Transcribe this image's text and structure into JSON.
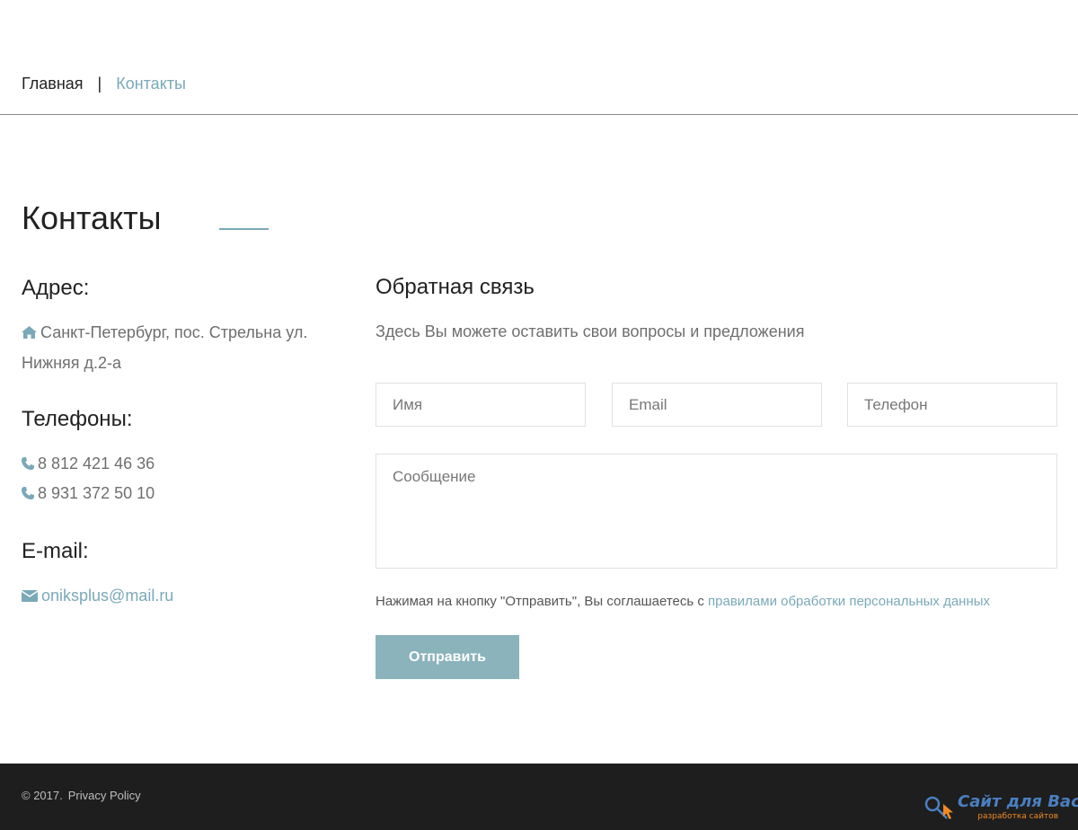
{
  "breadcrumb": {
    "home": "Главная",
    "separator": "|",
    "current": "Контакты"
  },
  "page_title": "Контакты",
  "address": {
    "heading": "Адрес:",
    "line1": "Санкт-Петербург, пос. Стрельна ул.",
    "line2": "Нижняя д.2-а",
    "icon": "home-icon"
  },
  "phones": {
    "heading": "Телефоны:",
    "items": [
      "8 812 421 46 36",
      "8 931 372 50 10"
    ],
    "icon": "phone-icon"
  },
  "email": {
    "heading": "E-mail:",
    "value": "oniksplus@mail.ru",
    "icon": "envelope-icon"
  },
  "feedback": {
    "heading": "Обратная связь",
    "subtitle": "Здесь Вы можете оставить свои вопросы и предложения",
    "name_placeholder": "Имя",
    "email_placeholder": "Email",
    "phone_placeholder": "Телефон",
    "message_placeholder": "Сообщение",
    "consent_text": "Нажимая на кнопку \"Отправить\", Вы соглашаетесь с ",
    "consent_link": "правилами обработки персональных данных",
    "submit_label": "Отправить"
  },
  "footer": {
    "copyright": "© 2017.",
    "privacy_link": "Privacy Policy",
    "dev_logo_main": "Сайт для Вас",
    "dev_logo_sub": "разработка сайтов"
  },
  "colors": {
    "accent": "#7aa9b8",
    "button": "#8bb3bc",
    "footer_bg": "#1e1e1e",
    "logo_blue": "#4a7fc0",
    "logo_orange": "#f08a24"
  }
}
